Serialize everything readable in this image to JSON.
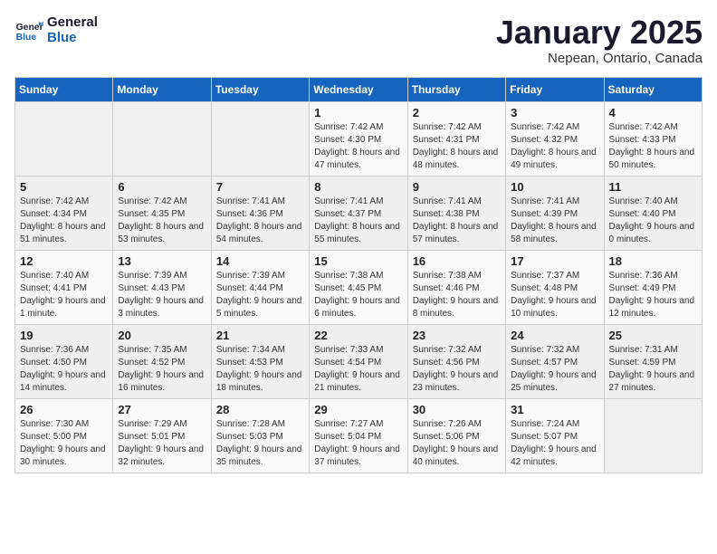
{
  "header": {
    "logo_line1": "General",
    "logo_line2": "Blue",
    "month": "January 2025",
    "location": "Nepean, Ontario, Canada"
  },
  "days_of_week": [
    "Sunday",
    "Monday",
    "Tuesday",
    "Wednesday",
    "Thursday",
    "Friday",
    "Saturday"
  ],
  "weeks": [
    [
      {
        "day": "",
        "info": ""
      },
      {
        "day": "",
        "info": ""
      },
      {
        "day": "",
        "info": ""
      },
      {
        "day": "1",
        "info": "Sunrise: 7:42 AM\nSunset: 4:30 PM\nDaylight: 8 hours and 47 minutes."
      },
      {
        "day": "2",
        "info": "Sunrise: 7:42 AM\nSunset: 4:31 PM\nDaylight: 8 hours and 48 minutes."
      },
      {
        "day": "3",
        "info": "Sunrise: 7:42 AM\nSunset: 4:32 PM\nDaylight: 8 hours and 49 minutes."
      },
      {
        "day": "4",
        "info": "Sunrise: 7:42 AM\nSunset: 4:33 PM\nDaylight: 8 hours and 50 minutes."
      }
    ],
    [
      {
        "day": "5",
        "info": "Sunrise: 7:42 AM\nSunset: 4:34 PM\nDaylight: 8 hours and 51 minutes."
      },
      {
        "day": "6",
        "info": "Sunrise: 7:42 AM\nSunset: 4:35 PM\nDaylight: 8 hours and 53 minutes."
      },
      {
        "day": "7",
        "info": "Sunrise: 7:41 AM\nSunset: 4:36 PM\nDaylight: 8 hours and 54 minutes."
      },
      {
        "day": "8",
        "info": "Sunrise: 7:41 AM\nSunset: 4:37 PM\nDaylight: 8 hours and 55 minutes."
      },
      {
        "day": "9",
        "info": "Sunrise: 7:41 AM\nSunset: 4:38 PM\nDaylight: 8 hours and 57 minutes."
      },
      {
        "day": "10",
        "info": "Sunrise: 7:41 AM\nSunset: 4:39 PM\nDaylight: 8 hours and 58 minutes."
      },
      {
        "day": "11",
        "info": "Sunrise: 7:40 AM\nSunset: 4:40 PM\nDaylight: 9 hours and 0 minutes."
      }
    ],
    [
      {
        "day": "12",
        "info": "Sunrise: 7:40 AM\nSunset: 4:41 PM\nDaylight: 9 hours and 1 minute."
      },
      {
        "day": "13",
        "info": "Sunrise: 7:39 AM\nSunset: 4:43 PM\nDaylight: 9 hours and 3 minutes."
      },
      {
        "day": "14",
        "info": "Sunrise: 7:39 AM\nSunset: 4:44 PM\nDaylight: 9 hours and 5 minutes."
      },
      {
        "day": "15",
        "info": "Sunrise: 7:38 AM\nSunset: 4:45 PM\nDaylight: 9 hours and 6 minutes."
      },
      {
        "day": "16",
        "info": "Sunrise: 7:38 AM\nSunset: 4:46 PM\nDaylight: 9 hours and 8 minutes."
      },
      {
        "day": "17",
        "info": "Sunrise: 7:37 AM\nSunset: 4:48 PM\nDaylight: 9 hours and 10 minutes."
      },
      {
        "day": "18",
        "info": "Sunrise: 7:36 AM\nSunset: 4:49 PM\nDaylight: 9 hours and 12 minutes."
      }
    ],
    [
      {
        "day": "19",
        "info": "Sunrise: 7:36 AM\nSunset: 4:50 PM\nDaylight: 9 hours and 14 minutes."
      },
      {
        "day": "20",
        "info": "Sunrise: 7:35 AM\nSunset: 4:52 PM\nDaylight: 9 hours and 16 minutes."
      },
      {
        "day": "21",
        "info": "Sunrise: 7:34 AM\nSunset: 4:53 PM\nDaylight: 9 hours and 18 minutes."
      },
      {
        "day": "22",
        "info": "Sunrise: 7:33 AM\nSunset: 4:54 PM\nDaylight: 9 hours and 21 minutes."
      },
      {
        "day": "23",
        "info": "Sunrise: 7:32 AM\nSunset: 4:56 PM\nDaylight: 9 hours and 23 minutes."
      },
      {
        "day": "24",
        "info": "Sunrise: 7:32 AM\nSunset: 4:57 PM\nDaylight: 9 hours and 25 minutes."
      },
      {
        "day": "25",
        "info": "Sunrise: 7:31 AM\nSunset: 4:59 PM\nDaylight: 9 hours and 27 minutes."
      }
    ],
    [
      {
        "day": "26",
        "info": "Sunrise: 7:30 AM\nSunset: 5:00 PM\nDaylight: 9 hours and 30 minutes."
      },
      {
        "day": "27",
        "info": "Sunrise: 7:29 AM\nSunset: 5:01 PM\nDaylight: 9 hours and 32 minutes."
      },
      {
        "day": "28",
        "info": "Sunrise: 7:28 AM\nSunset: 5:03 PM\nDaylight: 9 hours and 35 minutes."
      },
      {
        "day": "29",
        "info": "Sunrise: 7:27 AM\nSunset: 5:04 PM\nDaylight: 9 hours and 37 minutes."
      },
      {
        "day": "30",
        "info": "Sunrise: 7:26 AM\nSunset: 5:06 PM\nDaylight: 9 hours and 40 minutes."
      },
      {
        "day": "31",
        "info": "Sunrise: 7:24 AM\nSunset: 5:07 PM\nDaylight: 9 hours and 42 minutes."
      },
      {
        "day": "",
        "info": ""
      }
    ]
  ]
}
